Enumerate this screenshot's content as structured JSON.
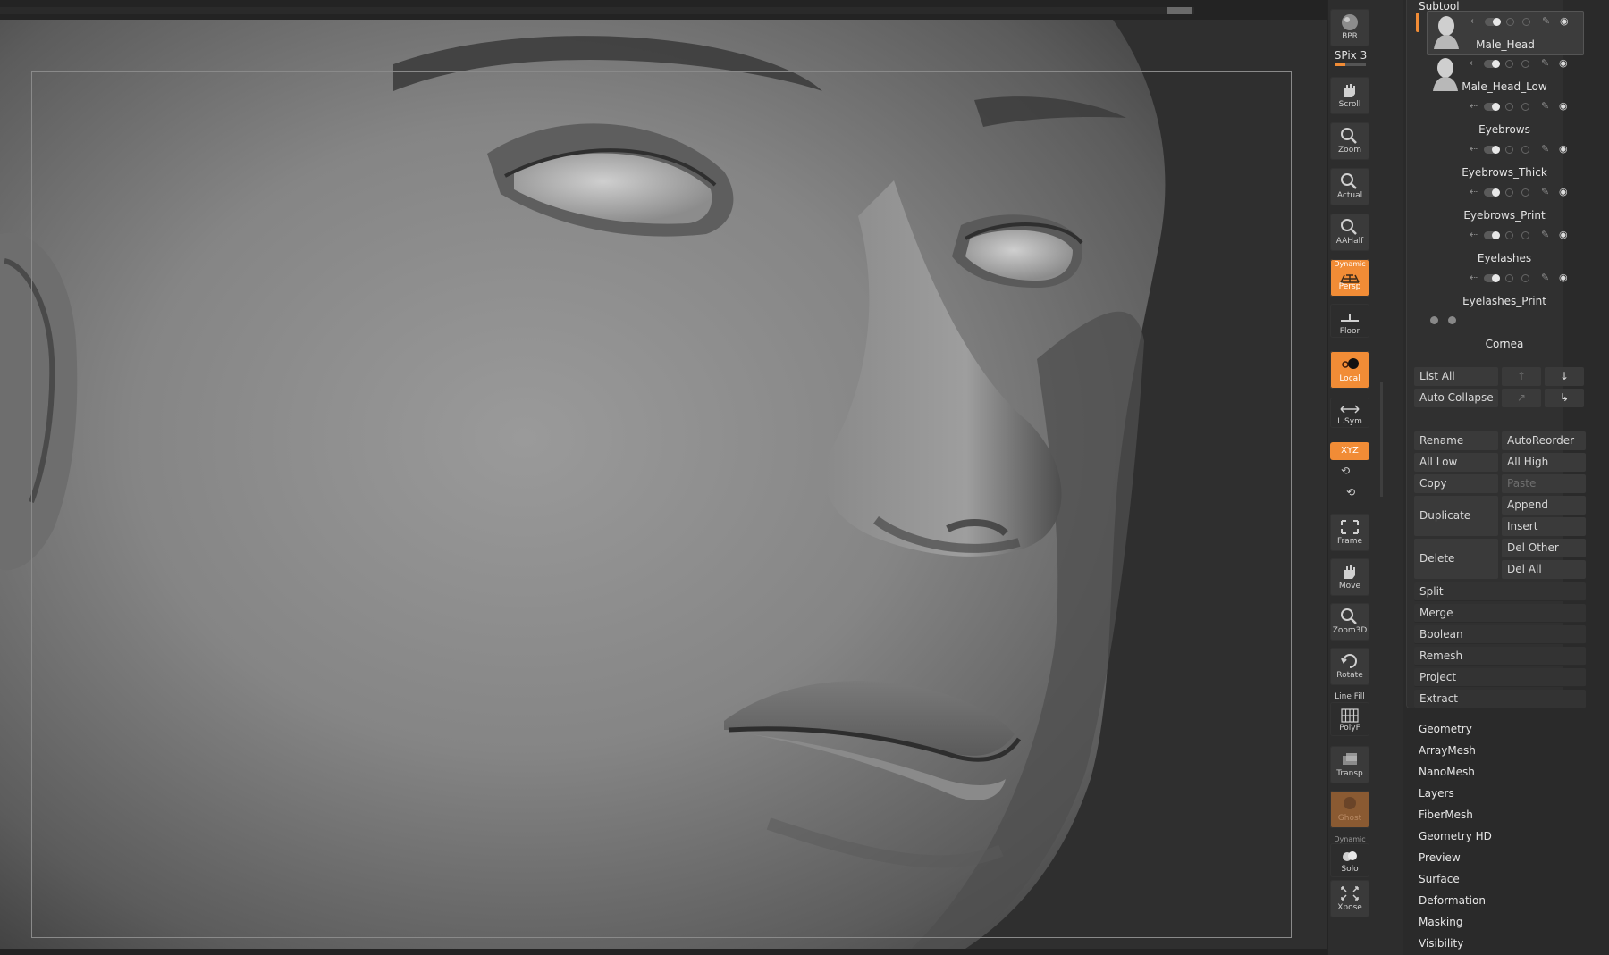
{
  "shelf": {
    "bpr": "BPR",
    "spix": "SPix 3",
    "spix_level": 0.33,
    "scroll": "Scroll",
    "zoom": "Zoom",
    "actual": "Actual",
    "aahalf": "AAHalf",
    "dynamic_top": "Dynamic",
    "persp": "Persp",
    "floor": "Floor",
    "local": "Local",
    "lsym": "L.Sym",
    "xyz": "XYZ",
    "frame": "Frame",
    "move": "Move",
    "zoom3d": "Zoom3D",
    "rotate": "Rotate",
    "line_fill": "Line Fill",
    "polyf": "PolyF",
    "transp": "Transp",
    "ghost": "Ghost",
    "dynamic_solo": "Dynamic",
    "solo": "Solo",
    "xpose": "Xpose"
  },
  "subtool": {
    "title": "Subtool",
    "items": [
      {
        "name": "Male_Head"
      },
      {
        "name": "Male_Head_Low"
      },
      {
        "name": "Eyebrows"
      },
      {
        "name": "Eyebrows_Thick"
      },
      {
        "name": "Eyebrows_Print"
      },
      {
        "name": "Eyelashes"
      },
      {
        "name": "Eyelashes_Print"
      },
      {
        "name": "Cornea"
      }
    ],
    "list_all": "List All",
    "auto_collapse": "Auto Collapse",
    "arrow_up": "↑",
    "arrow_down": "↓",
    "arrow_up_right": "↗",
    "arrow_down_right": "↳",
    "rename": "Rename",
    "autoreorder": "AutoReorder",
    "all_low": "All Low",
    "all_high": "All High",
    "copy": "Copy",
    "paste": "Paste",
    "duplicate": "Duplicate",
    "append": "Append",
    "insert": "Insert",
    "delete": "Delete",
    "del_other": "Del Other",
    "del_all": "Del All",
    "split": "Split",
    "merge": "Merge",
    "boolean": "Boolean",
    "remesh": "Remesh",
    "project": "Project",
    "extract": "Extract"
  },
  "tool_menu": [
    "Geometry",
    "ArrayMesh",
    "NanoMesh",
    "Layers",
    "FiberMesh",
    "Geometry HD",
    "Preview",
    "Surface",
    "Deformation",
    "Masking",
    "Visibility"
  ]
}
